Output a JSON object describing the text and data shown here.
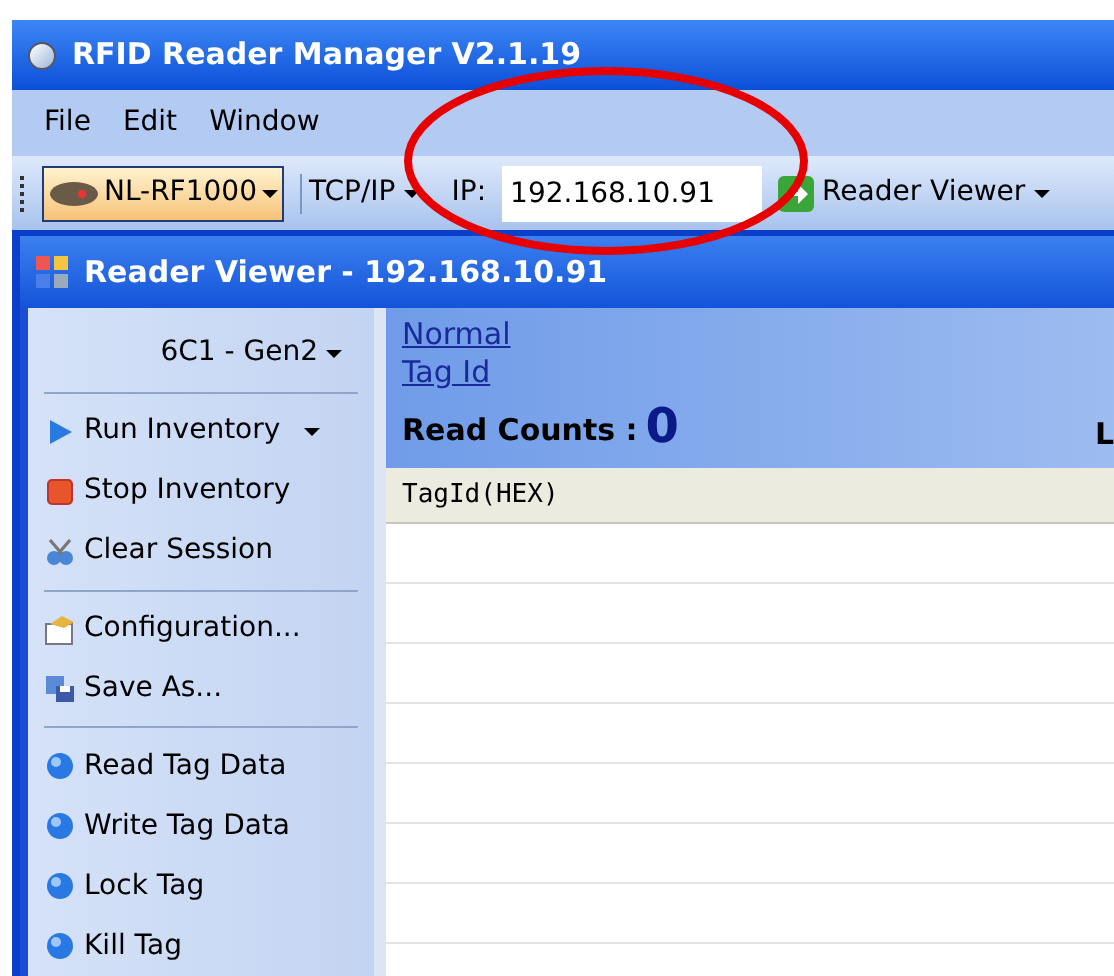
{
  "window": {
    "title": "RFID Reader Manager V2.1.19"
  },
  "menu": [
    {
      "label": "File"
    },
    {
      "label": "Edit"
    },
    {
      "label": "Window"
    }
  ],
  "toolbar": {
    "device": "NL-RF1000",
    "protocol": "TCP/IP",
    "ip_label": "IP:",
    "ip_value": "192.168.10.91",
    "viewer": {
      "label": "Reader Viewer"
    }
  },
  "reader_viewer": {
    "title": "Reader Viewer - 192.168.10.91",
    "sidebar": {
      "mode": "6C1 - Gen2",
      "groups": [
        [
          {
            "kind": "run",
            "label": "Run Inventory",
            "dropdown": true
          },
          {
            "kind": "stop",
            "label": "Stop Inventory",
            "dropdown": false
          },
          {
            "kind": "clear",
            "label": "Clear Session",
            "dropdown": false
          }
        ],
        [
          {
            "kind": "config",
            "label": "Configuration...",
            "dropdown": false
          },
          {
            "kind": "save",
            "label": "Save As...",
            "dropdown": false
          }
        ],
        [
          {
            "kind": "tag",
            "label": "Read Tag Data",
            "dropdown": false
          },
          {
            "kind": "tag",
            "label": "Write Tag Data",
            "dropdown": false
          },
          {
            "kind": "tag",
            "label": "Lock Tag",
            "dropdown": false
          },
          {
            "kind": "tag",
            "label": "Kill Tag",
            "dropdown": false
          }
        ]
      ]
    },
    "links": [
      "Normal",
      "Tag Id"
    ],
    "read_counts_label": "Read Counts :",
    "read_counts": "0",
    "column_2_label": "L",
    "table": {
      "columns": [
        "TagId(HEX)"
      ]
    }
  },
  "annotation": {
    "kind": "ellipse"
  }
}
